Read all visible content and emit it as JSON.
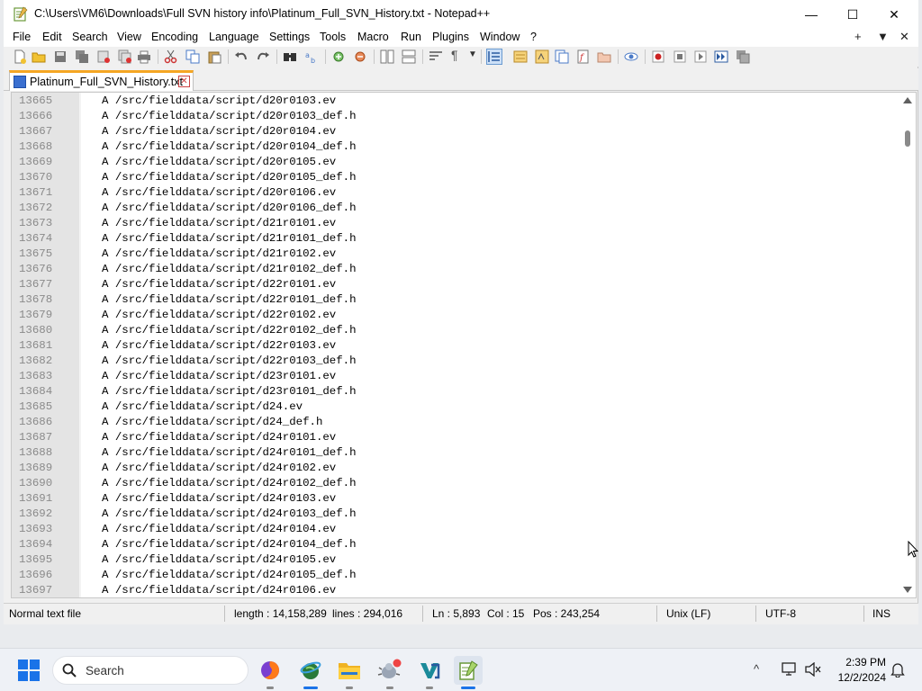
{
  "window": {
    "title": "C:\\Users\\VM6\\Downloads\\Full SVN history info\\Platinum_Full_SVN_History.txt - Notepad++",
    "minimize": "—",
    "maximize": "☐",
    "close": "✕"
  },
  "menu": {
    "items": [
      "File",
      "Edit",
      "Search",
      "View",
      "Encoding",
      "Language",
      "Settings",
      "Tools",
      "Macro",
      "Run",
      "Plugins",
      "Window",
      "?"
    ],
    "right": [
      "+",
      "▼",
      "✕"
    ]
  },
  "tab": {
    "label": "Platinum_Full_SVN_History.txt",
    "close": "✕"
  },
  "editor": {
    "lines": [
      {
        "n": "13665",
        "t": "A /src/fielddata/script/d20r0103.ev"
      },
      {
        "n": "13666",
        "t": "A /src/fielddata/script/d20r0103_def.h"
      },
      {
        "n": "13667",
        "t": "A /src/fielddata/script/d20r0104.ev"
      },
      {
        "n": "13668",
        "t": "A /src/fielddata/script/d20r0104_def.h"
      },
      {
        "n": "13669",
        "t": "A /src/fielddata/script/d20r0105.ev"
      },
      {
        "n": "13670",
        "t": "A /src/fielddata/script/d20r0105_def.h"
      },
      {
        "n": "13671",
        "t": "A /src/fielddata/script/d20r0106.ev"
      },
      {
        "n": "13672",
        "t": "A /src/fielddata/script/d20r0106_def.h"
      },
      {
        "n": "13673",
        "t": "A /src/fielddata/script/d21r0101.ev"
      },
      {
        "n": "13674",
        "t": "A /src/fielddata/script/d21r0101_def.h"
      },
      {
        "n": "13675",
        "t": "A /src/fielddata/script/d21r0102.ev"
      },
      {
        "n": "13676",
        "t": "A /src/fielddata/script/d21r0102_def.h"
      },
      {
        "n": "13677",
        "t": "A /src/fielddata/script/d22r0101.ev"
      },
      {
        "n": "13678",
        "t": "A /src/fielddata/script/d22r0101_def.h"
      },
      {
        "n": "13679",
        "t": "A /src/fielddata/script/d22r0102.ev"
      },
      {
        "n": "13680",
        "t": "A /src/fielddata/script/d22r0102_def.h"
      },
      {
        "n": "13681",
        "t": "A /src/fielddata/script/d22r0103.ev"
      },
      {
        "n": "13682",
        "t": "A /src/fielddata/script/d22r0103_def.h"
      },
      {
        "n": "13683",
        "t": "A /src/fielddata/script/d23r0101.ev"
      },
      {
        "n": "13684",
        "t": "A /src/fielddata/script/d23r0101_def.h"
      },
      {
        "n": "13685",
        "t": "A /src/fielddata/script/d24.ev"
      },
      {
        "n": "13686",
        "t": "A /src/fielddata/script/d24_def.h"
      },
      {
        "n": "13687",
        "t": "A /src/fielddata/script/d24r0101.ev"
      },
      {
        "n": "13688",
        "t": "A /src/fielddata/script/d24r0101_def.h"
      },
      {
        "n": "13689",
        "t": "A /src/fielddata/script/d24r0102.ev"
      },
      {
        "n": "13690",
        "t": "A /src/fielddata/script/d24r0102_def.h"
      },
      {
        "n": "13691",
        "t": "A /src/fielddata/script/d24r0103.ev"
      },
      {
        "n": "13692",
        "t": "A /src/fielddata/script/d24r0103_def.h"
      },
      {
        "n": "13693",
        "t": "A /src/fielddata/script/d24r0104.ev"
      },
      {
        "n": "13694",
        "t": "A /src/fielddata/script/d24r0104_def.h"
      },
      {
        "n": "13695",
        "t": "A /src/fielddata/script/d24r0105.ev"
      },
      {
        "n": "13696",
        "t": "A /src/fielddata/script/d24r0105_def.h"
      },
      {
        "n": "13697",
        "t": "A /src/fielddata/script/d24r0106.ev"
      }
    ],
    "scroll_fraction": 0.046
  },
  "status": {
    "file_type": "Normal text file",
    "length": "length : 14,158,289",
    "lines": "lines : 294,016",
    "ln": "Ln : 5,893",
    "col": "Col : 15",
    "pos": "Pos : 243,254",
    "eol": "Unix (LF)",
    "encoding": "UTF-8",
    "mode": "INS"
  },
  "taskbar": {
    "search_placeholder": "Search",
    "apps": [
      "firefox-icon",
      "globe-app-icon",
      "file-explorer-icon",
      "bug-tool-icon",
      "vs-code-icon",
      "notepad-plus-plus-icon"
    ],
    "tray_chevron": "^",
    "time": "2:39 PM",
    "date": "12/2/2024"
  },
  "colors": {
    "accent_tab": "#f5a623",
    "taskbar_active": "#1a73e8",
    "line_number": "#8a8a8a"
  }
}
